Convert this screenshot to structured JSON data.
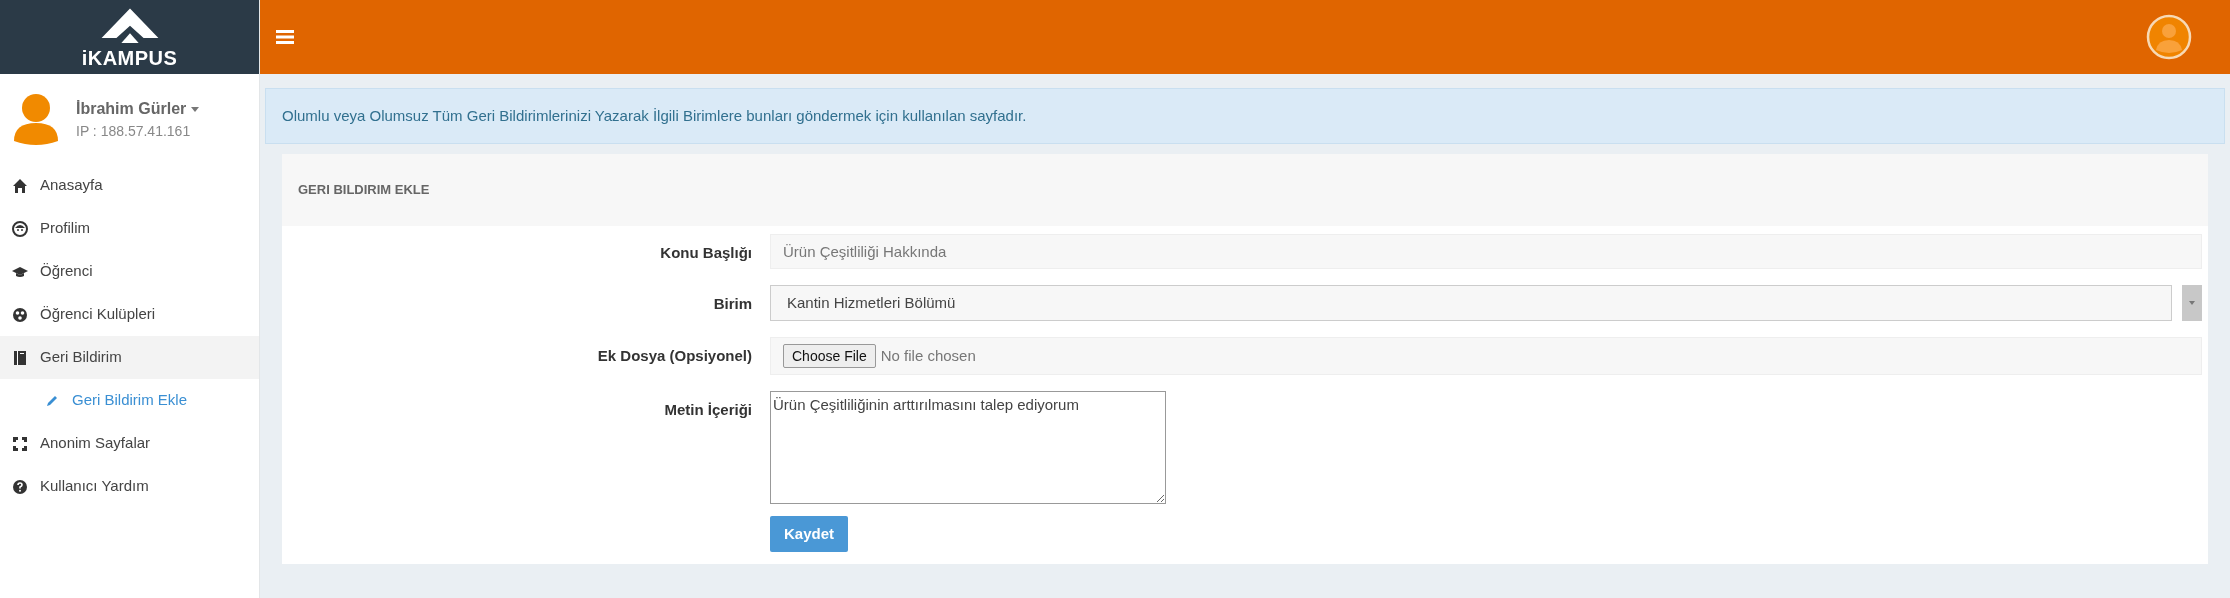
{
  "brand": {
    "name": "iKAMPUS"
  },
  "user": {
    "name": "İbrahim Gürler",
    "ip": "IP : 188.57.41.161"
  },
  "menu": [
    {
      "label": "Anasayfa",
      "kind": "home",
      "selected": false
    },
    {
      "label": "Profilim",
      "kind": "face",
      "selected": false
    },
    {
      "label": "Öğrenci",
      "kind": "cap",
      "selected": false
    },
    {
      "label": "Öğrenci Kulüpleri",
      "kind": "club",
      "selected": false
    },
    {
      "label": "Geri Bildirim",
      "kind": "book",
      "selected": true,
      "children": [
        {
          "label": "Geri Bildirim Ekle",
          "kind": "pencil",
          "selected": true
        }
      ]
    },
    {
      "label": "Anonim Sayfalar",
      "kind": "frame",
      "selected": false
    },
    {
      "label": "Kullanıcı Yardım",
      "kind": "help",
      "selected": false
    }
  ],
  "info": "Olumlu veya Olumsuz Tüm Geri Bildirimlerinizi Yazarak İlgili Birimlere bunları göndermek için kullanılan sayfadır.",
  "panel": {
    "title": "GERI BILDIRIM EKLE",
    "fields": [
      {
        "kind": "text",
        "label": "Konu Başlığı",
        "value": "Ürün Çeşitliliği Hakkında"
      },
      {
        "kind": "select",
        "label": "Birim",
        "value": "Kantin Hizmetleri Bölümü"
      },
      {
        "kind": "file",
        "label": "Ek Dosya (Opsiyonel)",
        "button": "Choose File",
        "status": "No file chosen"
      },
      {
        "kind": "textarea",
        "label": "Metin İçeriği",
        "value": "Ürün Çeşitliliğinin arttırılmasını talep ediyorum"
      }
    ],
    "submit": "Kaydet"
  }
}
